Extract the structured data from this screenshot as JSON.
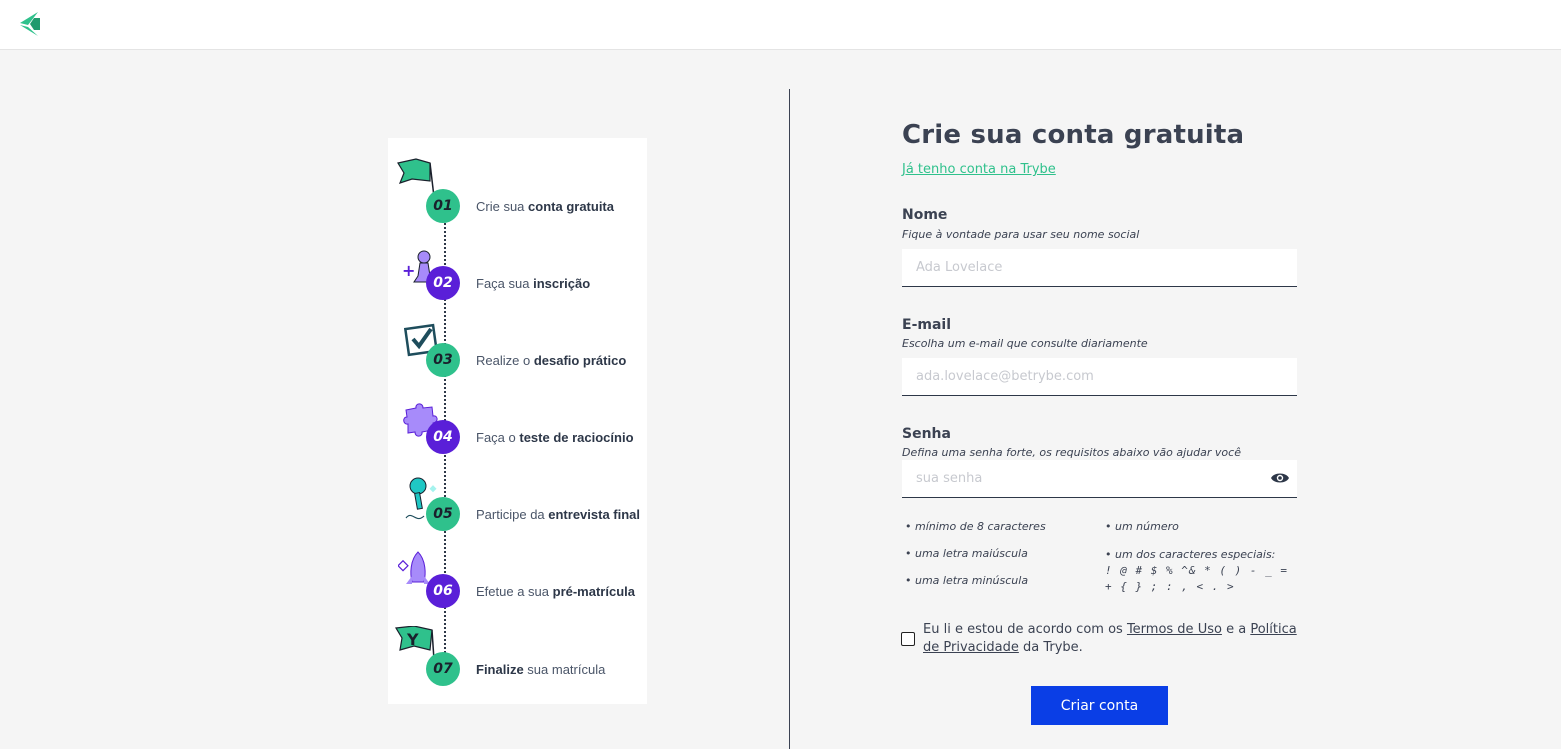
{
  "colors": {
    "brand_green": "#2fc18c",
    "brand_purple": "#5a1fd8",
    "button_blue": "#0a3ee6",
    "text": "#3b4252"
  },
  "header": {
    "logo_icon": "trybe-logo-icon"
  },
  "steps": [
    {
      "number": "01",
      "pre": "Crie sua ",
      "bold": "conta gratuita",
      "post": "",
      "color": "green",
      "icon": "flag-icon"
    },
    {
      "number": "02",
      "pre": "Faça sua ",
      "bold": "inscrição",
      "post": "",
      "color": "purple",
      "icon": "game-pawn-icon"
    },
    {
      "number": "03",
      "pre": "Realize o ",
      "bold": "desafio prático",
      "post": "",
      "color": "green",
      "icon": "checkbox-icon"
    },
    {
      "number": "04",
      "pre": "Faça o ",
      "bold": "teste de raciocínio",
      "post": "",
      "color": "purple",
      "icon": "puzzle-piece-icon"
    },
    {
      "number": "05",
      "pre": "Participe da ",
      "bold": "entrevista final",
      "post": "",
      "color": "green",
      "icon": "microphone-icon"
    },
    {
      "number": "06",
      "pre": "Efetue a sua ",
      "bold": "pré-matrícula",
      "post": "",
      "color": "purple",
      "icon": "rocket-icon"
    },
    {
      "number": "07",
      "pre": "",
      "bold": "Finalize",
      "post": " sua matrícula",
      "color": "green",
      "icon": "trybe-flag-icon"
    }
  ],
  "form": {
    "title": "Crie sua conta gratuita",
    "login_link": "Já tenho conta na Trybe",
    "name": {
      "label": "Nome",
      "hint": "Fique à vontade para usar seu nome social",
      "placeholder": "Ada Lovelace",
      "value": ""
    },
    "email": {
      "label": "E-mail",
      "hint": "Escolha um e-mail que consulte diariamente",
      "placeholder": "ada.lovelace@betrybe.com",
      "value": ""
    },
    "password": {
      "label": "Senha",
      "hint": "Defina uma senha forte, os requisitos abaixo vão ajudar você",
      "placeholder": "sua senha",
      "value": "",
      "toggle_icon": "eye-icon"
    },
    "requirements": {
      "min_chars": "• mínimo de 8 caracteres",
      "uppercase": "• uma letra maiúscula",
      "lowercase": "• uma letra minúscula",
      "number": "• um número",
      "special": "• um dos caracteres especiais:",
      "special_chars": "! @ # $ % ^& * ( ) - _ = + { } ; : , < . >"
    },
    "terms": {
      "checked": false,
      "text_1": "Eu li e estou de acordo com os ",
      "terms_link": "Termos de Uso",
      "text_2": " e a ",
      "privacy_link": "Política de Privacidade",
      "text_3": " da Trybe."
    },
    "submit_label": "Criar conta"
  }
}
